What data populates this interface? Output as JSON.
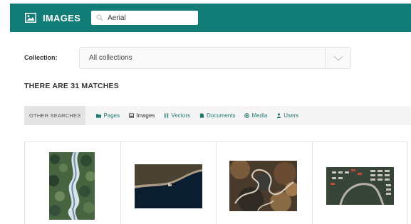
{
  "header": {
    "title": "IMAGES",
    "icon": "image-icon",
    "accent": "#127d76",
    "search": {
      "value": "Aerial",
      "icon": "search-icon"
    }
  },
  "filter": {
    "label": "Collection:",
    "selected": "All collections",
    "icon": "chevron-down-icon"
  },
  "results": {
    "heading": "THERE ARE 31 MATCHES"
  },
  "other_searches": {
    "label": "OTHER SEARCHES",
    "links": [
      {
        "label": "Pages",
        "icon": "folder-icon"
      },
      {
        "label": "Images",
        "icon": "image-icon"
      },
      {
        "label": "Vectors",
        "icon": "grid-dots-icon"
      },
      {
        "label": "Documents",
        "icon": "document-icon"
      },
      {
        "label": "Media",
        "icon": "play-circle-icon"
      },
      {
        "label": "Users",
        "icon": "user-icon"
      }
    ]
  },
  "images": [
    {
      "subject": "aerial river through snowy forest"
    },
    {
      "subject": "aerial coastline at night"
    },
    {
      "subject": "aerial winding mountain road"
    },
    {
      "subject": "aerial neighborhood with curved road"
    }
  ]
}
